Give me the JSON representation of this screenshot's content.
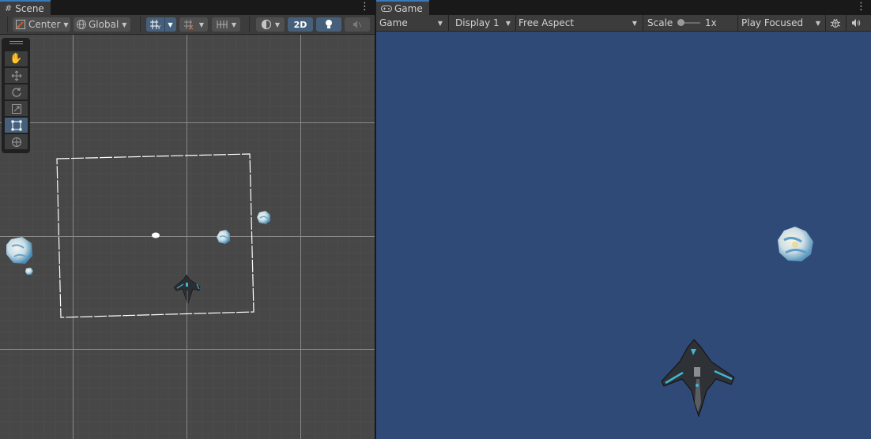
{
  "scene": {
    "tab_label": "Scene",
    "tab_icon": "hash-icon",
    "menu_icon": "kebab-icon",
    "toolbar": {
      "pivot_label": "Center",
      "space_label": "Global",
      "mode_2d_label": "2D"
    },
    "tools": [
      "hand-tool",
      "move-tool",
      "rotate-tool",
      "scale-tool",
      "rect-tool",
      "transform-tool"
    ],
    "active_tool": "rect-tool"
  },
  "game": {
    "tab_label": "Game",
    "tab_icon": "gamepad-icon",
    "menu_icon": "kebab-icon",
    "toolbar": {
      "view_label": "Game",
      "display_label": "Display 1",
      "aspect_label": "Free Aspect",
      "scale_label": "Scale",
      "scale_value": "1x",
      "scale_fraction": 0.0,
      "play_mode_label": "Play Focused"
    },
    "background_color": "#304a78"
  },
  "colors": {
    "accent": "#46607c",
    "tab_highlight": "#3a79bb"
  }
}
